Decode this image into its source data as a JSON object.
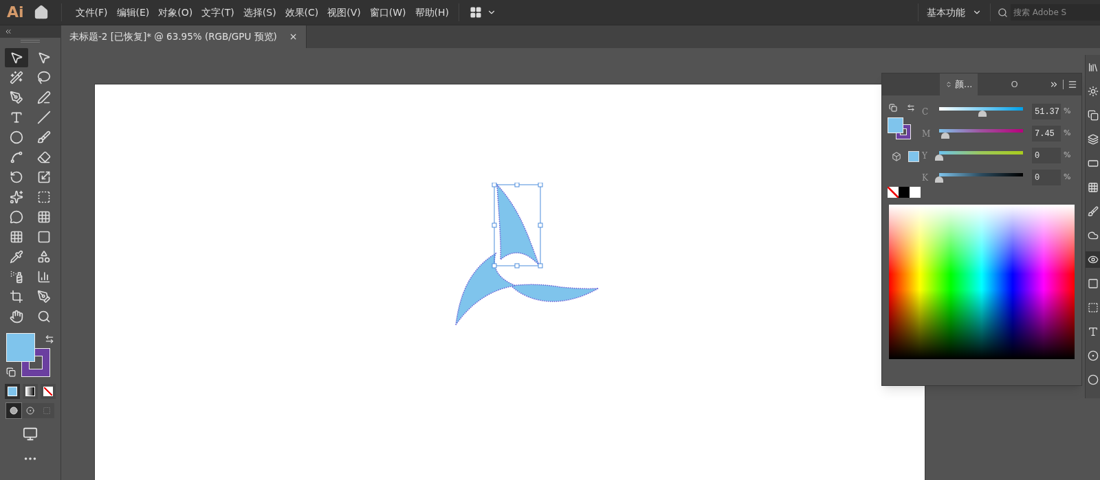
{
  "app_logo": "Ai",
  "menu_bar": {
    "items": [
      "文件(F)",
      "编辑(E)",
      "对象(O)",
      "文字(T)",
      "选择(S)",
      "效果(C)",
      "视图(V)",
      "窗口(W)",
      "帮助(H)"
    ],
    "workspace": "基本功能",
    "search": {
      "placeholder": "搜索 Adobe S"
    }
  },
  "document_tab": {
    "title": "未标题-2 [已恢复]* @ 63.95% (RGB/GPU 预览)",
    "close": "×"
  },
  "tools": [
    {
      "kind": "selection",
      "selected": true
    },
    {
      "kind": "direct",
      "selected": false
    },
    {
      "kind": "wand",
      "selected": false
    },
    {
      "kind": "lasso",
      "selected": false
    },
    {
      "kind": "pen",
      "selected": false
    },
    {
      "kind": "curvature",
      "selected": false
    },
    {
      "kind": "type",
      "selected": false
    },
    {
      "kind": "line",
      "selected": false
    },
    {
      "kind": "ellipse",
      "selected": false
    },
    {
      "kind": "brush",
      "selected": false
    },
    {
      "kind": "shaper",
      "selected": false
    },
    {
      "kind": "eraser",
      "selected": false
    },
    {
      "kind": "rotate",
      "selected": false
    },
    {
      "kind": "scale",
      "selected": false
    },
    {
      "kind": "warp",
      "selected": false
    },
    {
      "kind": "free-transform",
      "selected": false
    },
    {
      "kind": "shape-builder",
      "selected": false
    },
    {
      "kind": "perspective",
      "selected": false
    },
    {
      "kind": "mesh",
      "selected": false
    },
    {
      "kind": "gradient",
      "selected": false
    },
    {
      "kind": "eyedropper",
      "selected": false
    },
    {
      "kind": "blend",
      "selected": false
    },
    {
      "kind": "symbol-sprayer",
      "selected": false
    },
    {
      "kind": "graph",
      "selected": false
    },
    {
      "kind": "artboard",
      "selected": false
    },
    {
      "kind": "slice",
      "selected": false
    },
    {
      "kind": "hand",
      "selected": false
    },
    {
      "kind": "zoom",
      "selected": false
    }
  ],
  "swatches": [
    {
      "kind": "fill",
      "color": "#7fc4ec"
    },
    {
      "kind": "stroke",
      "color": "#6b3fa0"
    }
  ],
  "color_modes": [
    {
      "kind": "color",
      "selected": true
    },
    {
      "kind": "gradient",
      "selected": false
    },
    {
      "kind": "none",
      "selected": false
    }
  ],
  "draw_modes": [
    {
      "kind": "normal",
      "selected": true
    },
    {
      "kind": "behind",
      "selected": false
    },
    {
      "kind": "inside",
      "selected": false
    }
  ],
  "color_panel": {
    "tabs": [
      {
        "label": "颜...",
        "selected": true
      },
      {
        "label": "O",
        "selected": false
      }
    ],
    "channels": [
      {
        "kind": "c",
        "label": "C",
        "level": 0.5137,
        "value": "51.37",
        "unit": "%"
      },
      {
        "kind": "m",
        "label": "M",
        "level": 0.0745,
        "value": "7.45",
        "unit": "%"
      },
      {
        "kind": "y",
        "label": "Y",
        "level": 0,
        "value": "0",
        "unit": "%"
      },
      {
        "kind": "k",
        "label": "K",
        "level": 0,
        "value": "0",
        "unit": "%"
      }
    ]
  },
  "dock_icons": [
    {
      "kind": "libraries",
      "selected": false
    },
    {
      "kind": "sun",
      "selected": false
    },
    {
      "kind": "properties",
      "selected": false
    },
    {
      "kind": "layers",
      "selected": false
    },
    {
      "kind": "artboards",
      "selected": false
    },
    {
      "kind": "swatches",
      "selected": false
    },
    {
      "kind": "brushes",
      "selected": false
    },
    {
      "kind": "symbols",
      "selected": false
    },
    {
      "kind": "appearance",
      "selected": true
    },
    {
      "kind": "gradient",
      "selected": false
    },
    {
      "kind": "transparency",
      "selected": false
    },
    {
      "kind": "type",
      "selected": false
    },
    {
      "kind": "dot",
      "selected": false
    },
    {
      "kind": "circle",
      "selected": false
    }
  ]
}
